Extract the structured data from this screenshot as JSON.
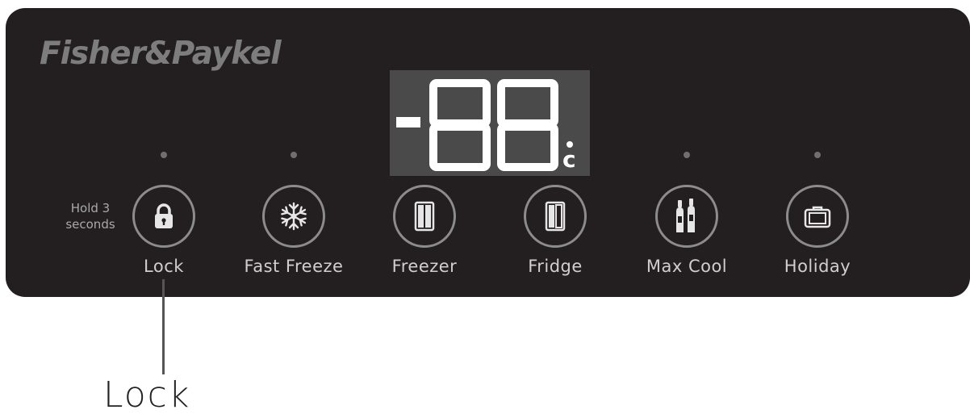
{
  "panel": {
    "brand": "Fisher&Paykel",
    "display": {
      "reading": "-88",
      "unit": "°C"
    },
    "hold_note": [
      "Hold 3",
      "seconds"
    ],
    "buttons": [
      {
        "label": "Lock",
        "icon": "lock-icon"
      },
      {
        "label": "Fast Freeze",
        "icon": "snowflake-icon"
      },
      {
        "label": "Freezer",
        "icon": "freezer-door-icon"
      },
      {
        "label": "Fridge",
        "icon": "fridge-door-icon"
      },
      {
        "label": "Max Cool",
        "icon": "bottles-icon"
      },
      {
        "label": "Holiday",
        "icon": "suitcase-icon"
      }
    ]
  },
  "callout": {
    "label": "Lock"
  },
  "colors": {
    "panel": "#231f20",
    "display_bg": "#4a4a4a",
    "segments": "#ffffff",
    "button_ring": "#8c8c8c",
    "labels": "#cfcfcf"
  }
}
